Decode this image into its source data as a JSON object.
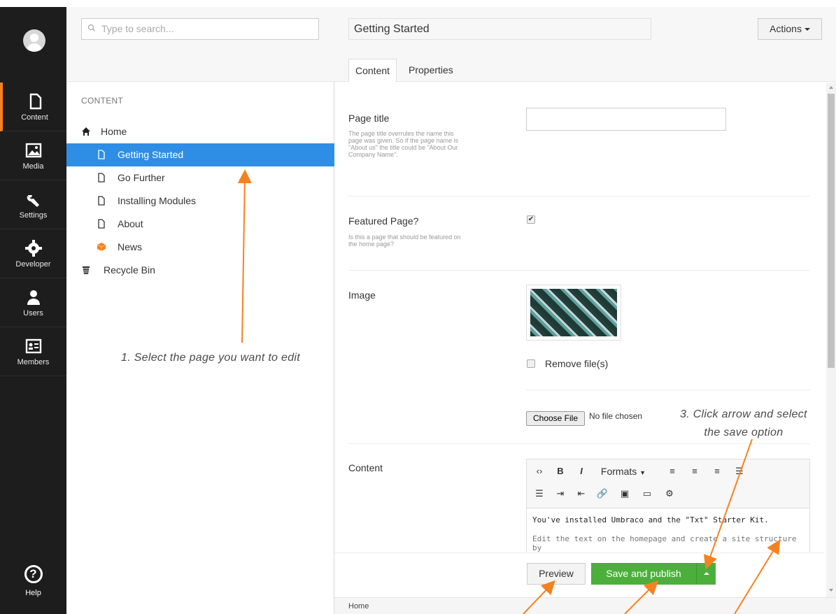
{
  "sections": [
    {
      "label": "Content",
      "icon": "document-icon",
      "active": true
    },
    {
      "label": "Media",
      "icon": "image-icon",
      "active": false
    },
    {
      "label": "Settings",
      "icon": "wrench-icon",
      "active": false
    },
    {
      "label": "Developer",
      "icon": "gear-icon",
      "active": false
    },
    {
      "label": "Users",
      "icon": "user-icon",
      "active": false
    },
    {
      "label": "Members",
      "icon": "id-card-icon",
      "active": false
    }
  ],
  "help": {
    "label": "Help",
    "glyph": "?"
  },
  "search": {
    "placeholder": "Type to search..."
  },
  "tree": {
    "title": "CONTENT",
    "nodes": [
      {
        "label": "Home",
        "icon": "home-icon",
        "selected": false
      },
      {
        "label": "Getting Started",
        "icon": "document-icon",
        "selected": true
      },
      {
        "label": "Go Further",
        "icon": "document-icon",
        "selected": false
      },
      {
        "label": "Installing Modules",
        "icon": "document-icon",
        "selected": false
      },
      {
        "label": "About",
        "icon": "document-icon",
        "selected": false
      },
      {
        "label": "News",
        "icon": "box-icon",
        "selected": false
      },
      {
        "label": "Recycle Bin",
        "icon": "trash-icon",
        "selected": false
      }
    ]
  },
  "editor": {
    "name_value": "Getting Started",
    "actions_label": "Actions",
    "tabs": [
      "Content",
      "Properties"
    ],
    "props": {
      "page_title": {
        "label": "Page title",
        "desc": "The page title overrules the name this page was given. So if the page name is \"About us\" the title could be \"About Our Company Name\"."
      },
      "featured": {
        "label": "Featured Page?",
        "desc": "Is this a page that should be featured on the home page?",
        "checked": true
      },
      "image": {
        "label": "Image",
        "remove_label": "Remove file(s)",
        "choose_label": "Choose File",
        "no_file": "No file chosen"
      },
      "content": {
        "label": "Content"
      }
    },
    "rte": {
      "toolbar": [
        "‹›",
        "B",
        "I",
        "Formats",
        "≡",
        "≡",
        "≡",
        "☰",
        "☰",
        "⇥",
        "⇤",
        "🔗",
        "▣",
        "▭",
        "⚙"
      ],
      "formats_label": "Formats",
      "line1": "You've installed Umbraco and the \"Txt\" Starter Kit.",
      "line2": "Edit the text on the homepage and create a site structure by"
    },
    "buttons": {
      "preview": "Preview",
      "publish": "Save and publish"
    },
    "footer_breadcrumb": "Home"
  },
  "annotations": {
    "note1": "1. Select the page you want to edit",
    "note3_line1": "3. Click arrow and select",
    "note3_line2": "the save option"
  },
  "colors": {
    "accent": "#f5821f",
    "selected": "#2e8ee5",
    "publish": "#4caf3c",
    "arrows": "#f5821f"
  }
}
